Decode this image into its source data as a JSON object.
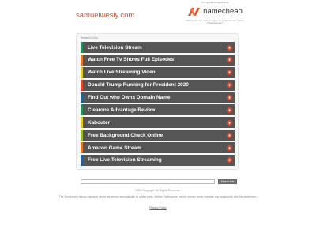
{
  "header": {
    "domain": "samuelwesly.com"
  },
  "registrar": {
    "note": "This domain is registered at",
    "brand": "namecheap",
    "description": "This domain was recently registered at Namecheap. Please check back later!"
  },
  "related": {
    "title": "Related Links",
    "links": [
      {
        "label": "Live Television Stream",
        "color": "#2c8c5a"
      },
      {
        "label": "Watch Free Tv Shows Full Episodes",
        "color": "#e07a2a"
      },
      {
        "label": "Watch Live Streaming Video",
        "color": "#e0c92a"
      },
      {
        "label": "Donald Trump Running for President 2020",
        "color": "#d84a2a"
      },
      {
        "label": "Find Out who Owns Domain Name",
        "color": "#2a5f8c"
      },
      {
        "label": "Clearone Advantage Review",
        "color": "#2c8c5a"
      },
      {
        "label": "Kabouter",
        "color": "#e0c92a"
      },
      {
        "label": "Free Background Check Online",
        "color": "#9bbf2a"
      },
      {
        "label": "Amazon Game Stream",
        "color": "#e07a2a"
      },
      {
        "label": "Free Live Television Streaming",
        "color": "#2a5f8c"
      }
    ],
    "arrow_color": "#e04a2a"
  },
  "search": {
    "placeholder": "",
    "button_label": "Search Ads"
  },
  "footer": {
    "copyright": "2020 Copyright. All Rights Reserved.",
    "disclaimer": "The Sponsored Listings displayed above are served automatically by a third party. Neither Parkingcrew nor the domain owner maintain any relationship with the advertisers.",
    "privacy": "Privacy Policy"
  }
}
